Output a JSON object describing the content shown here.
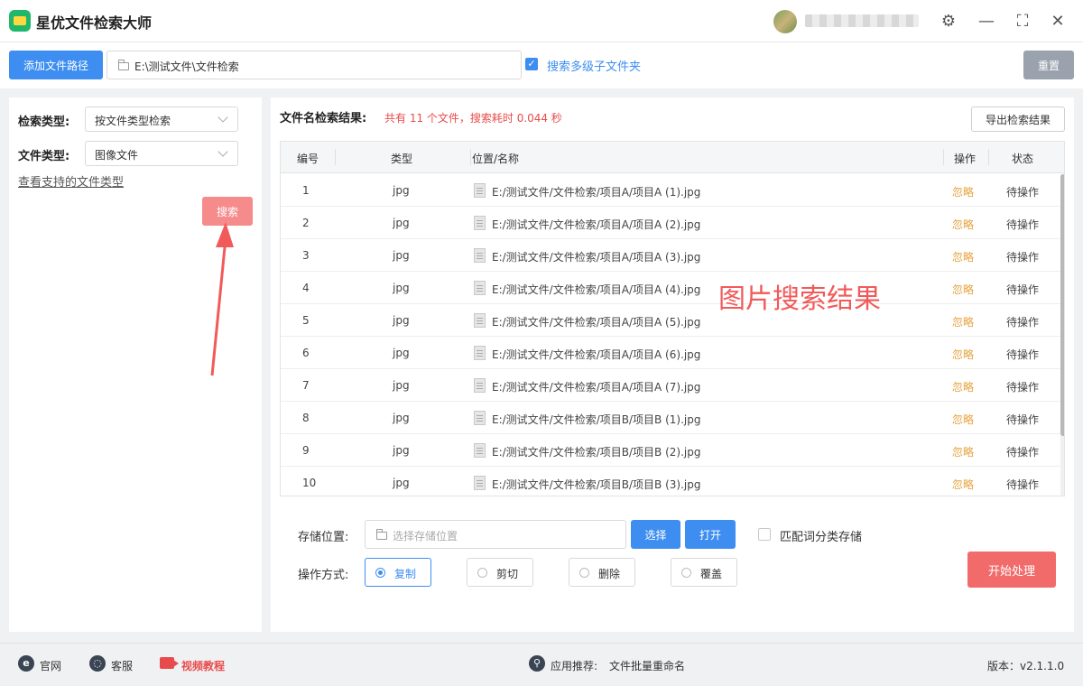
{
  "app": {
    "title": "星优文件检索大师"
  },
  "window_controls": {
    "settings_glyph": "⚙",
    "minimize_glyph": "—",
    "maximize_glyph": "⛶",
    "close_glyph": "✕"
  },
  "toolbar": {
    "add_path_label": "添加文件路径",
    "path_value": "E:\\测试文件\\文件检索",
    "subfolder_label": "搜索多级子文件夹",
    "subfolder_checked": true,
    "reset_label": "重置"
  },
  "left": {
    "search_type_label": "检索类型:",
    "search_type_value": "按文件类型检索",
    "file_type_label": "文件类型:",
    "file_type_value": "图像文件",
    "supported_link": "查看支持的文件类型",
    "search_button": "搜索"
  },
  "results": {
    "title": "文件名检索结果:",
    "summary": "共有 11 个文件，搜索耗时 0.044 秒",
    "export_label": "导出检索结果",
    "columns": {
      "num": "编号",
      "type": "类型",
      "path": "位置/名称",
      "action": "操作",
      "status": "状态"
    },
    "rows": [
      {
        "num": "1",
        "type": "jpg",
        "path": "E:/测试文件/文件检索/项目A/项目A (1).jpg",
        "action": "忽略",
        "status": "待操作"
      },
      {
        "num": "2",
        "type": "jpg",
        "path": "E:/测试文件/文件检索/项目A/项目A (2).jpg",
        "action": "忽略",
        "status": "待操作"
      },
      {
        "num": "3",
        "type": "jpg",
        "path": "E:/测试文件/文件检索/项目A/项目A (3).jpg",
        "action": "忽略",
        "status": "待操作"
      },
      {
        "num": "4",
        "type": "jpg",
        "path": "E:/测试文件/文件检索/项目A/项目A (4).jpg",
        "action": "忽略",
        "status": "待操作"
      },
      {
        "num": "5",
        "type": "jpg",
        "path": "E:/测试文件/文件检索/项目A/项目A (5).jpg",
        "action": "忽略",
        "status": "待操作"
      },
      {
        "num": "6",
        "type": "jpg",
        "path": "E:/测试文件/文件检索/项目A/项目A (6).jpg",
        "action": "忽略",
        "status": "待操作"
      },
      {
        "num": "7",
        "type": "jpg",
        "path": "E:/测试文件/文件检索/项目A/项目A (7).jpg",
        "action": "忽略",
        "status": "待操作"
      },
      {
        "num": "8",
        "type": "jpg",
        "path": "E:/测试文件/文件检索/项目B/项目B (1).jpg",
        "action": "忽略",
        "status": "待操作"
      },
      {
        "num": "9",
        "type": "jpg",
        "path": "E:/测试文件/文件检索/项目B/项目B (2).jpg",
        "action": "忽略",
        "status": "待操作"
      },
      {
        "num": "10",
        "type": "jpg",
        "path": "E:/测试文件/文件检索/项目B/项目B (3).jpg",
        "action": "忽略",
        "status": "待操作"
      }
    ],
    "overlay_annotation": "图片搜索结果"
  },
  "options": {
    "storage_label": "存储位置:",
    "storage_placeholder": "选择存储位置",
    "choose_label": "选择",
    "open_label": "打开",
    "match_label": "匹配词分类存储",
    "operation_label": "操作方式:",
    "radios": [
      {
        "label": "复制",
        "selected": true
      },
      {
        "label": "剪切",
        "selected": false
      },
      {
        "label": "删除",
        "selected": false
      },
      {
        "label": "覆盖",
        "selected": false
      }
    ],
    "start_label": "开始处理"
  },
  "statusbar": {
    "website_label": "官网",
    "support_label": "客服",
    "video_label": "视频教程",
    "recommend_label": "应用推荐:",
    "recommend_app": "文件批量重命名",
    "version": "版本：v2.1.1.0"
  },
  "colors": {
    "accent": "#3d8ef0",
    "danger": "#f26b6b",
    "warn": "#e6a23c"
  }
}
